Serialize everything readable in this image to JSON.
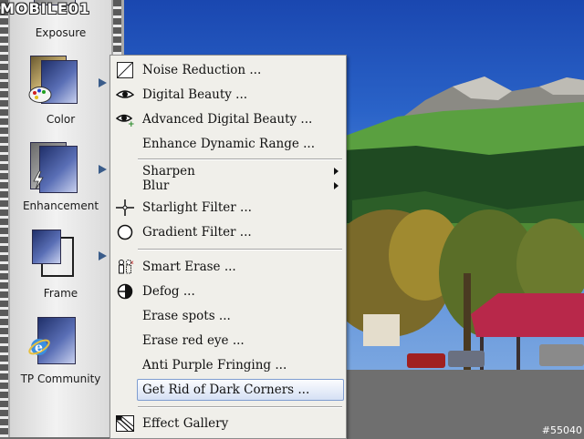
{
  "watermark": {
    "site": "MOBILE01",
    "id": "#55040"
  },
  "sidebar": {
    "tools": [
      {
        "label": "Exposure"
      },
      {
        "label": "Color"
      },
      {
        "label": "Enhancement"
      },
      {
        "label": "Frame"
      },
      {
        "label": "TP Community"
      }
    ]
  },
  "menu": {
    "items": [
      {
        "label": "Noise Reduction ...",
        "icon": "noise-reduction-icon"
      },
      {
        "label": "Digital Beauty ...",
        "icon": "eye-icon"
      },
      {
        "label": "Advanced Digital Beauty ...",
        "icon": "eye-plus-icon"
      },
      {
        "label": "Enhance Dynamic Range ..."
      },
      {
        "label": "Sharpen",
        "submenu": true
      },
      {
        "label": "Blur",
        "submenu": true
      },
      {
        "label": "Starlight Filter ...",
        "icon": "starlight-icon"
      },
      {
        "label": "Gradient Filter ...",
        "icon": "gradient-circle-icon"
      },
      {
        "label": "Smart Erase ...",
        "icon": "smart-erase-icon"
      },
      {
        "label": "Defog ...",
        "icon": "defog-icon"
      },
      {
        "label": "Erase spots ..."
      },
      {
        "label": "Erase red eye ..."
      },
      {
        "label": "Anti Purple Fringing ..."
      },
      {
        "label": "Get Rid of Dark Corners ...",
        "selected": true
      },
      {
        "label": "Effect Gallery",
        "icon": "effect-gallery-icon"
      }
    ]
  }
}
